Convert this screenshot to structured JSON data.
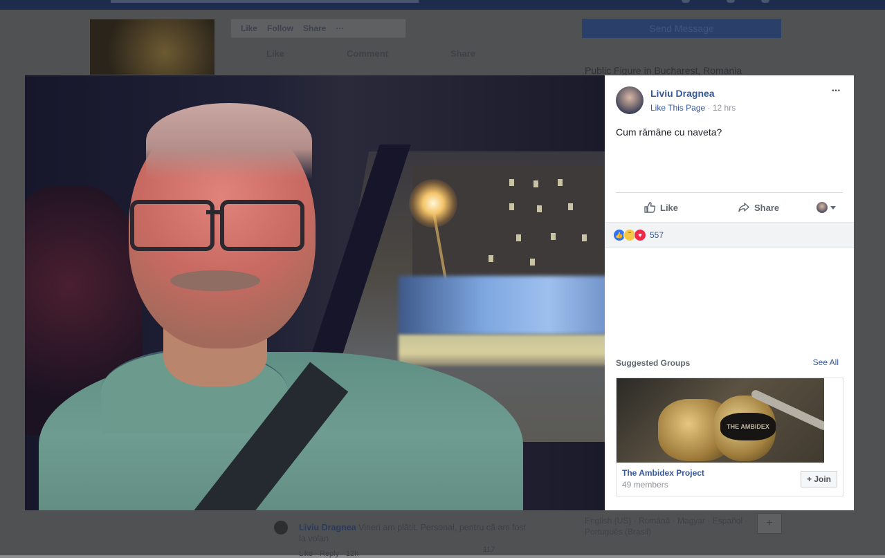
{
  "background": {
    "action_bar": [
      "Like",
      "Follow",
      "Share",
      "···"
    ],
    "send_message": "Send Message",
    "post_actions": [
      "Like",
      "Comment",
      "Share"
    ],
    "public_figure": "Public Figure in Bucharest, Romania",
    "comment": {
      "author": "Liviu Dragnea",
      "text": "Vineri am plătit. Personal, pentru că am fost la volan",
      "meta": "Like · Reply · 12h",
      "reactions": "117"
    },
    "languages": "English (US) · Română · Magyar · Español · Português (Brasil)",
    "plus": "+"
  },
  "panel": {
    "author": "Liviu Dragnea",
    "like_page": "Like This Page",
    "time": " · 12 hrs",
    "more": "···",
    "caption": "Cum rămâne cu naveta?",
    "like_label": "Like",
    "share_label": "Share",
    "reaction_count": "557",
    "reactions": [
      "like-icon",
      "haha-icon",
      "love-icon"
    ]
  },
  "suggested": {
    "title": "Suggested Groups",
    "see_all": "See All",
    "group_name": "The Ambidex Project",
    "members": "49 members",
    "join": "+ Join",
    "image_text": "THE AMBIDEX"
  },
  "colors": {
    "link": "#365899",
    "topbar": "#1d2c4c",
    "panel_bg": "#ffffff"
  }
}
